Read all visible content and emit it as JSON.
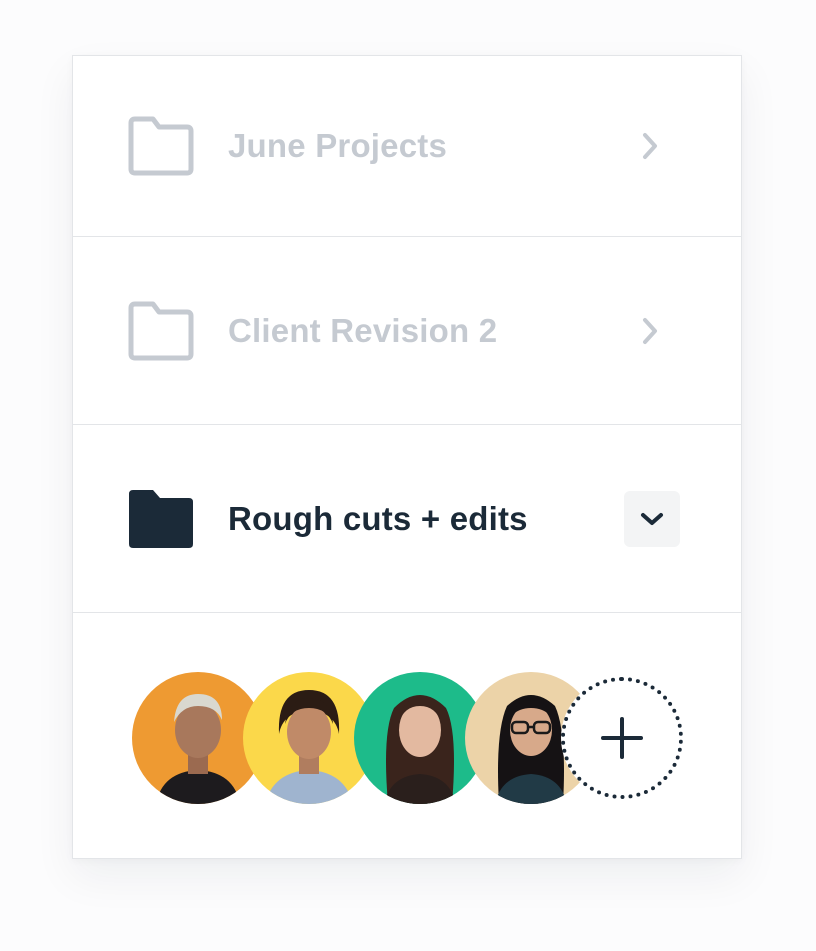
{
  "folders": [
    {
      "label": "June Projects",
      "state": "collapsed",
      "icon": "folder-outline-icon"
    },
    {
      "label": "Client Revision 2",
      "state": "collapsed",
      "icon": "folder-outline-icon"
    },
    {
      "label": "Rough cuts + edits",
      "state": "expanded",
      "icon": "folder-filled-icon"
    }
  ],
  "members": [
    {
      "avatar_bg": "#ee9a32",
      "icon": "avatar-person"
    },
    {
      "avatar_bg": "#fbd84a",
      "icon": "avatar-person"
    },
    {
      "avatar_bg": "#1dbb8a",
      "icon": "avatar-person"
    },
    {
      "avatar_bg": "#ecd3a8",
      "icon": "avatar-person"
    }
  ],
  "add_member": {
    "icon": "plus-icon"
  },
  "colors": {
    "text_primary": "#1b2a38",
    "text_muted": "#c5cad1",
    "border": "#e3e5e8",
    "button_bg": "#f3f4f5"
  }
}
